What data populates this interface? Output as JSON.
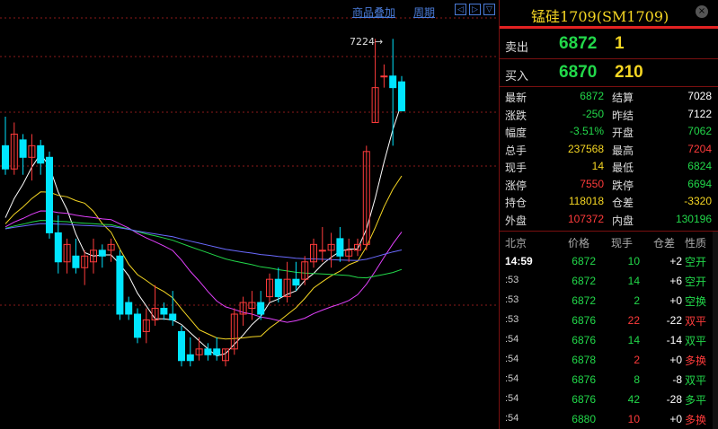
{
  "toolbar": {
    "overlay_link": "商品叠加",
    "period_link": "周期",
    "nav_prev": "◁",
    "nav_next": "▷",
    "nav_down": "▽"
  },
  "chart": {
    "high_marker": "7224",
    "colors": {
      "up": "#ff3b3b",
      "down": "#00e5ff",
      "ma5": "#ffffff",
      "ma10": "#f5d623",
      "ma20": "#e040fb",
      "ma40": "#22d84a",
      "ma60": "#6a6aff",
      "grid": "#8b1a1a"
    }
  },
  "chart_data": {
    "type": "candlestick",
    "price_range": [
      6580,
      7260
    ],
    "candles": [
      {
        "o": 7040,
        "h": 7090,
        "l": 6990,
        "c": 7000
      },
      {
        "o": 7000,
        "h": 7080,
        "l": 6990,
        "c": 7060
      },
      {
        "o": 7050,
        "h": 7060,
        "l": 6990,
        "c": 7020
      },
      {
        "o": 7020,
        "h": 7060,
        "l": 6980,
        "c": 7040
      },
      {
        "o": 7040,
        "h": 7050,
        "l": 6990,
        "c": 7010
      },
      {
        "o": 7020,
        "h": 7030,
        "l": 6880,
        "c": 6890
      },
      {
        "o": 6890,
        "h": 6920,
        "l": 6820,
        "c": 6840
      },
      {
        "o": 6840,
        "h": 6880,
        "l": 6820,
        "c": 6870
      },
      {
        "o": 6850,
        "h": 6880,
        "l": 6820,
        "c": 6830
      },
      {
        "o": 6830,
        "h": 6860,
        "l": 6800,
        "c": 6850
      },
      {
        "o": 6840,
        "h": 6880,
        "l": 6820,
        "c": 6860
      },
      {
        "o": 6860,
        "h": 6870,
        "l": 6830,
        "c": 6850
      },
      {
        "o": 6860,
        "h": 6880,
        "l": 6840,
        "c": 6870
      },
      {
        "o": 6850,
        "h": 6860,
        "l": 6740,
        "c": 6750
      },
      {
        "o": 6770,
        "h": 6780,
        "l": 6740,
        "c": 6750
      },
      {
        "o": 6750,
        "h": 6760,
        "l": 6700,
        "c": 6710
      },
      {
        "o": 6720,
        "h": 6760,
        "l": 6700,
        "c": 6740
      },
      {
        "o": 6740,
        "h": 6800,
        "l": 6730,
        "c": 6760
      },
      {
        "o": 6760,
        "h": 6770,
        "l": 6740,
        "c": 6750
      },
      {
        "o": 6750,
        "h": 6790,
        "l": 6730,
        "c": 6740
      },
      {
        "o": 6720,
        "h": 6730,
        "l": 6660,
        "c": 6670
      },
      {
        "o": 6680,
        "h": 6710,
        "l": 6660,
        "c": 6670
      },
      {
        "o": 6680,
        "h": 6710,
        "l": 6670,
        "c": 6690
      },
      {
        "o": 6690,
        "h": 6700,
        "l": 6670,
        "c": 6680
      },
      {
        "o": 6690,
        "h": 6710,
        "l": 6670,
        "c": 6680
      },
      {
        "o": 6670,
        "h": 6690,
        "l": 6660,
        "c": 6690
      },
      {
        "o": 6690,
        "h": 6760,
        "l": 6680,
        "c": 6750
      },
      {
        "o": 6750,
        "h": 6780,
        "l": 6730,
        "c": 6770
      },
      {
        "o": 6760,
        "h": 6790,
        "l": 6740,
        "c": 6770
      },
      {
        "o": 6770,
        "h": 6790,
        "l": 6740,
        "c": 6750
      },
      {
        "o": 6780,
        "h": 6820,
        "l": 6770,
        "c": 6810
      },
      {
        "o": 6810,
        "h": 6830,
        "l": 6770,
        "c": 6780
      },
      {
        "o": 6780,
        "h": 6840,
        "l": 6770,
        "c": 6810
      },
      {
        "o": 6810,
        "h": 6840,
        "l": 6790,
        "c": 6800
      },
      {
        "o": 6810,
        "h": 6850,
        "l": 6800,
        "c": 6840
      },
      {
        "o": 6840,
        "h": 6880,
        "l": 6830,
        "c": 6870
      },
      {
        "o": 6860,
        "h": 6900,
        "l": 6840,
        "c": 6860
      },
      {
        "o": 6860,
        "h": 6890,
        "l": 6830,
        "c": 6870
      },
      {
        "o": 6880,
        "h": 6900,
        "l": 6840,
        "c": 6850
      },
      {
        "o": 6850,
        "h": 6880,
        "l": 6840,
        "c": 6860
      },
      {
        "o": 6860,
        "h": 6880,
        "l": 6850,
        "c": 6870
      },
      {
        "o": 6870,
        "h": 7040,
        "l": 6860,
        "c": 7030
      },
      {
        "o": 7080,
        "h": 7224,
        "l": 7080,
        "c": 7140
      },
      {
        "o": 7160,
        "h": 7180,
        "l": 7140,
        "c": 7160
      },
      {
        "o": 7160,
        "h": 7224,
        "l": 7040,
        "c": 7140
      },
      {
        "o": 7150,
        "h": 7160,
        "l": 7100,
        "c": 7100
      }
    ]
  },
  "panel": {
    "title": "锰硅1709(SM1709)",
    "close_icon": "×",
    "sell": {
      "label": "卖出",
      "price": "6872",
      "vol": "1"
    },
    "buy": {
      "label": "买入",
      "price": "6870",
      "vol": "210"
    },
    "quotes": [
      {
        "l1": "最新",
        "v1": "6872",
        "c1": "#22d84a",
        "l2": "结算",
        "v2": "7028",
        "c2": "#ffffff"
      },
      {
        "l1": "涨跌",
        "v1": "-250",
        "c1": "#22d84a",
        "l2": "昨结",
        "v2": "7122",
        "c2": "#ffffff"
      },
      {
        "l1": "幅度",
        "v1": "-3.51%",
        "c1": "#22d84a",
        "l2": "开盘",
        "v2": "7062",
        "c2": "#22d84a"
      },
      {
        "l1": "总手",
        "v1": "237568",
        "c1": "#f5d623",
        "l2": "最高",
        "v2": "7204",
        "c2": "#ff3b3b"
      },
      {
        "l1": "现手",
        "v1": "14",
        "c1": "#f5d623",
        "l2": "最低",
        "v2": "6824",
        "c2": "#22d84a"
      },
      {
        "l1": "涨停",
        "v1": "7550",
        "c1": "#ff3b3b",
        "l2": "跌停",
        "v2": "6694",
        "c2": "#22d84a"
      },
      {
        "l1": "持仓",
        "v1": "118018",
        "c1": "#f5d623",
        "l2": "仓差",
        "v2": "-3320",
        "c2": "#f5d623"
      },
      {
        "l1": "外盘",
        "v1": "107372",
        "c1": "#ff3b3b",
        "l2": "内盘",
        "v2": "130196",
        "c2": "#22d84a"
      }
    ],
    "trade_headers": {
      "time": "北京",
      "price": "价格",
      "vol": "现手",
      "chg": "仓差",
      "nature": "性质"
    },
    "trades": [
      {
        "time": "14:59",
        "price": "6872",
        "pc": "#22d84a",
        "vol": "10",
        "vc": "#22d84a",
        "chg": "+2",
        "nat": "空开",
        "nc": "#22d84a"
      },
      {
        "time": ":53",
        "price": "6872",
        "pc": "#22d84a",
        "vol": "14",
        "vc": "#22d84a",
        "chg": "+6",
        "nat": "空开",
        "nc": "#22d84a"
      },
      {
        "time": ":53",
        "price": "6872",
        "pc": "#22d84a",
        "vol": "2",
        "vc": "#22d84a",
        "chg": "+0",
        "nat": "空换",
        "nc": "#22d84a"
      },
      {
        "time": ":53",
        "price": "6876",
        "pc": "#22d84a",
        "vol": "22",
        "vc": "#ff3b3b",
        "chg": "-22",
        "nat": "双平",
        "nc": "#ff3b3b"
      },
      {
        "time": ":54",
        "price": "6876",
        "pc": "#22d84a",
        "vol": "14",
        "vc": "#22d84a",
        "chg": "-14",
        "nat": "双平",
        "nc": "#22d84a"
      },
      {
        "time": ":54",
        "price": "6878",
        "pc": "#22d84a",
        "vol": "2",
        "vc": "#ff3b3b",
        "chg": "+0",
        "nat": "多换",
        "nc": "#ff3b3b"
      },
      {
        "time": ":54",
        "price": "6876",
        "pc": "#22d84a",
        "vol": "8",
        "vc": "#22d84a",
        "chg": "-8",
        "nat": "双平",
        "nc": "#22d84a"
      },
      {
        "time": ":54",
        "price": "6876",
        "pc": "#22d84a",
        "vol": "42",
        "vc": "#22d84a",
        "chg": "-28",
        "nat": "多平",
        "nc": "#22d84a"
      },
      {
        "time": ":54",
        "price": "6880",
        "pc": "#22d84a",
        "vol": "10",
        "vc": "#ff3b3b",
        "chg": "+0",
        "nat": "多换",
        "nc": "#ff3b3b"
      }
    ]
  }
}
